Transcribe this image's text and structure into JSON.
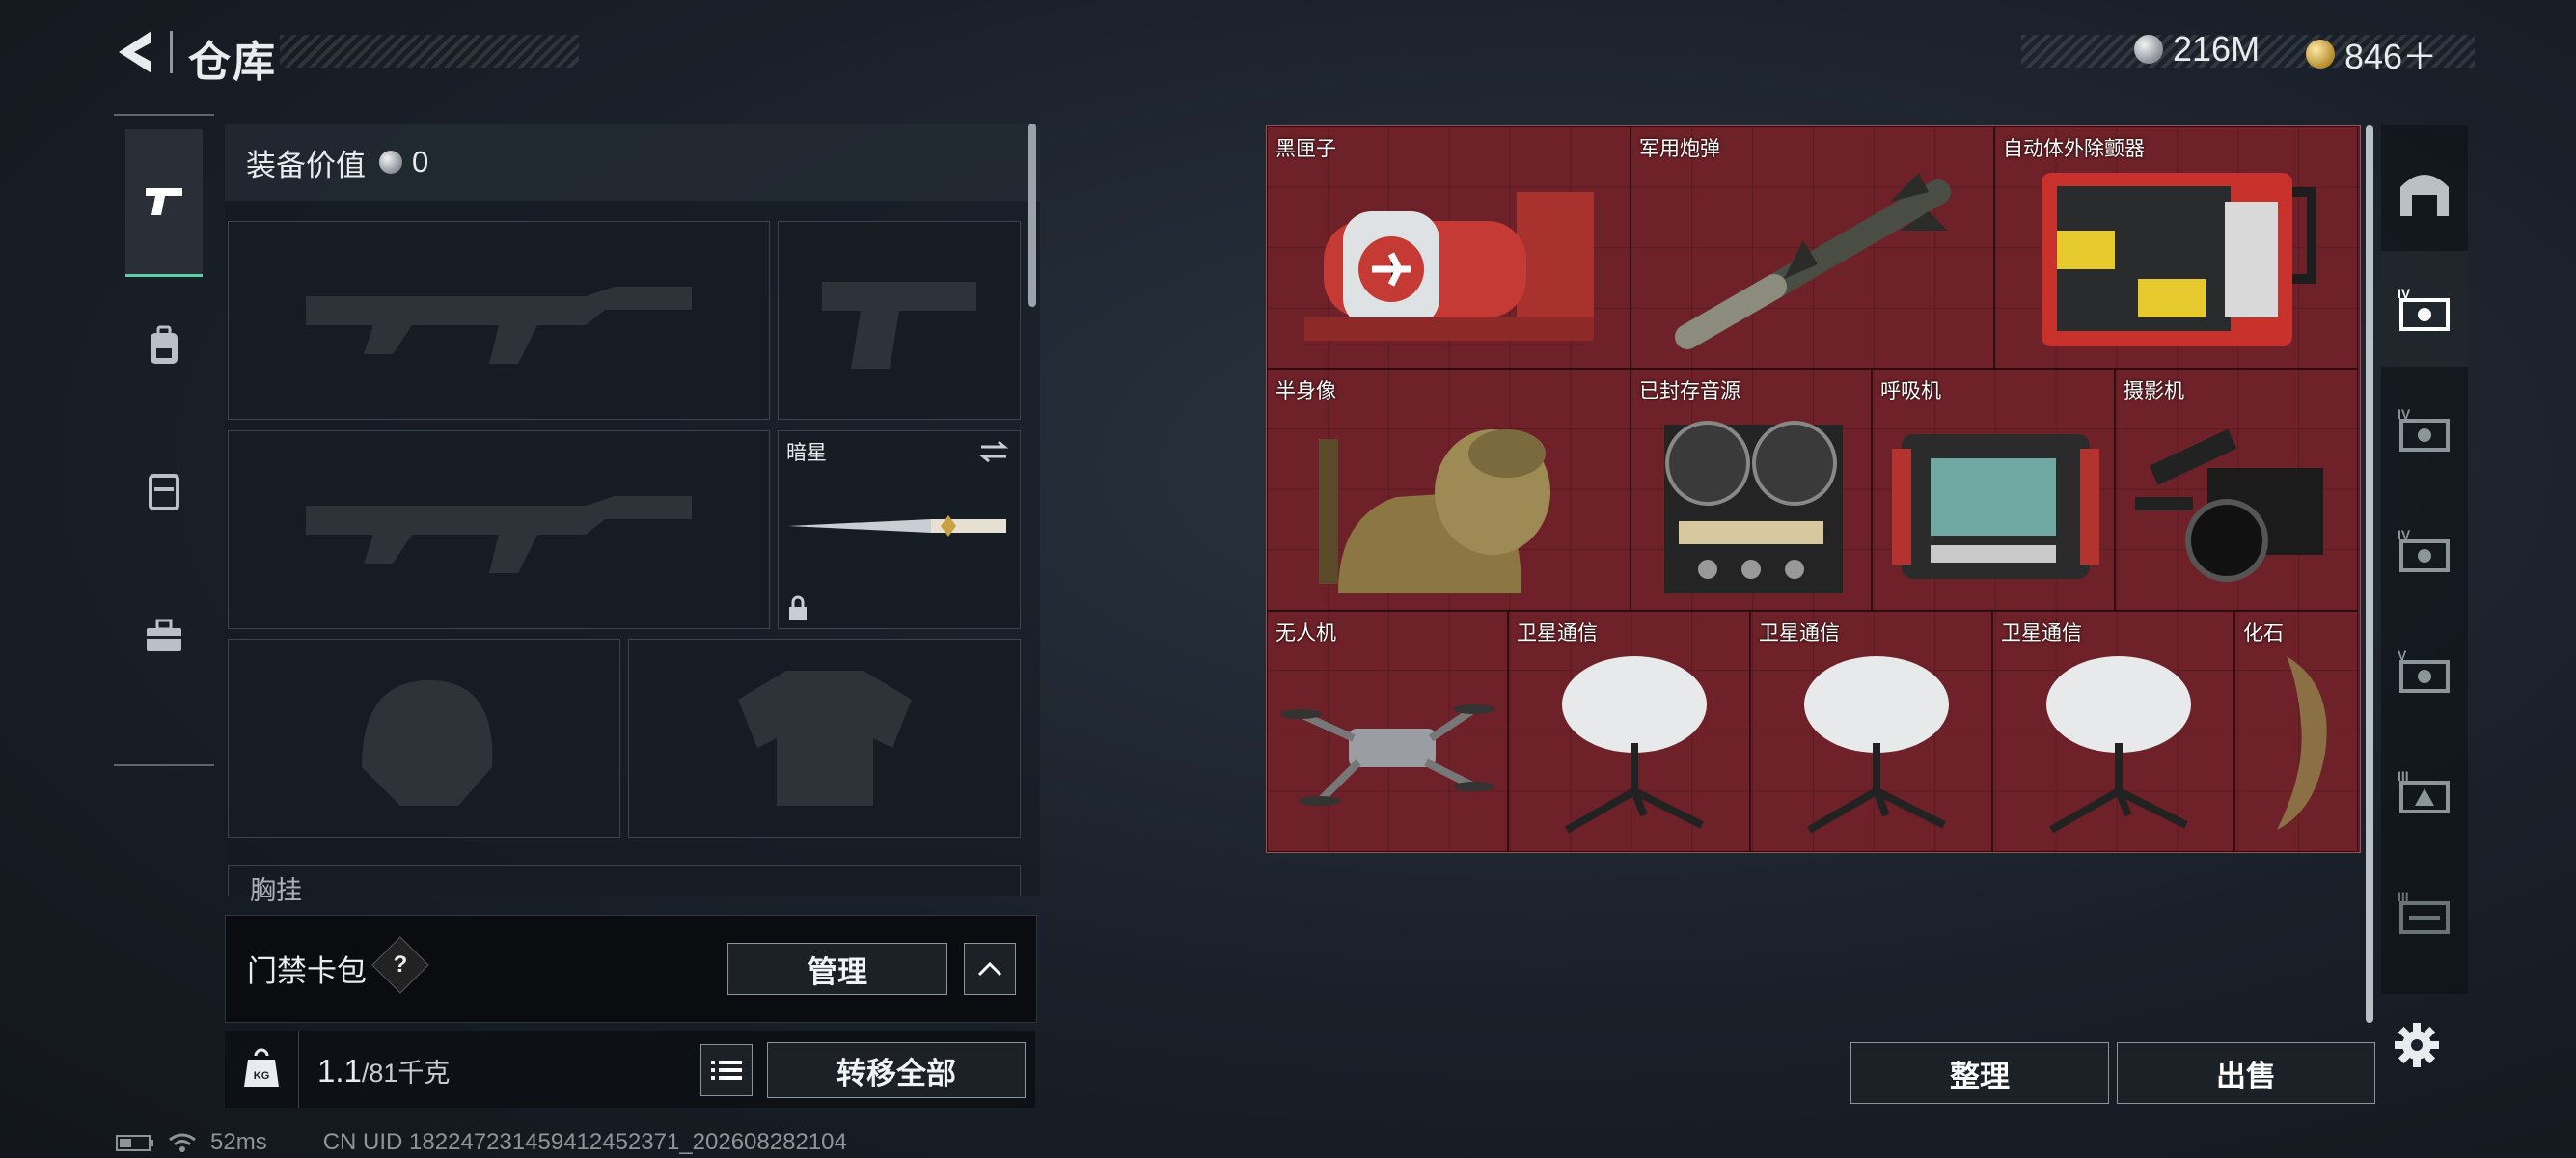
{
  "header": {
    "title": "仓库",
    "currencies": [
      {
        "icon": "silver-coin-icon",
        "value": "216M"
      },
      {
        "icon": "gold-coin-icon",
        "value": "846＋"
      }
    ]
  },
  "left_tabs": [
    {
      "icon": "pistol-icon",
      "active": true
    },
    {
      "icon": "backpack-icon",
      "active": false
    },
    {
      "icon": "vest-icon",
      "active": false
    },
    {
      "icon": "briefcase-icon",
      "active": false
    }
  ],
  "equipment": {
    "value_label": "装备价值",
    "value": "0",
    "melee_name": "暗星",
    "next_section_partial": "胸挂"
  },
  "card_pack": {
    "label": "门禁卡包",
    "help": "?",
    "manage": "管理"
  },
  "weight": {
    "current": "1.1",
    "max": "/81千克",
    "transfer_all": "转移全部"
  },
  "stash_items": [
    {
      "name": "黑匣子",
      "icon": "black-box-icon"
    },
    {
      "name": "军用炮弹",
      "icon": "missile-icon"
    },
    {
      "name": "自动体外除颤器",
      "icon": "aed-icon"
    },
    {
      "name": "半身像",
      "icon": "bust-statue-icon"
    },
    {
      "name": "已封存音源",
      "icon": "reel-to-reel-icon"
    },
    {
      "name": "呼吸机",
      "icon": "ventilator-icon"
    },
    {
      "name": "摄影机",
      "icon": "camera-icon"
    },
    {
      "name": "无人机",
      "icon": "drone-icon"
    },
    {
      "name": "卫星通信",
      "icon": "satellite-dish-icon"
    },
    {
      "name": "卫星通信",
      "icon": "satellite-dish-icon"
    },
    {
      "name": "卫星通信",
      "icon": "satellite-dish-icon"
    },
    {
      "name": "化石",
      "icon": "fossil-claw-icon"
    }
  ],
  "side_tabs": [
    {
      "icon": "safe-box-icon",
      "tier": ""
    },
    {
      "icon": "container-icon",
      "tier": "IV"
    },
    {
      "icon": "container-icon",
      "tier": "IV"
    },
    {
      "icon": "container-icon",
      "tier": "IV"
    },
    {
      "icon": "container-icon",
      "tier": "V"
    },
    {
      "icon": "container-icon",
      "tier": "III"
    },
    {
      "icon": "container-icon",
      "tier": "III"
    }
  ],
  "actions": {
    "sort": "整理",
    "sell": "出售"
  },
  "status_bar": {
    "ping": "52ms",
    "uid": "CN UID 18224723145941245237​1_202608282104"
  },
  "colors": {
    "accent": "#5fd0a6",
    "stash_bg": "#6e2128"
  }
}
